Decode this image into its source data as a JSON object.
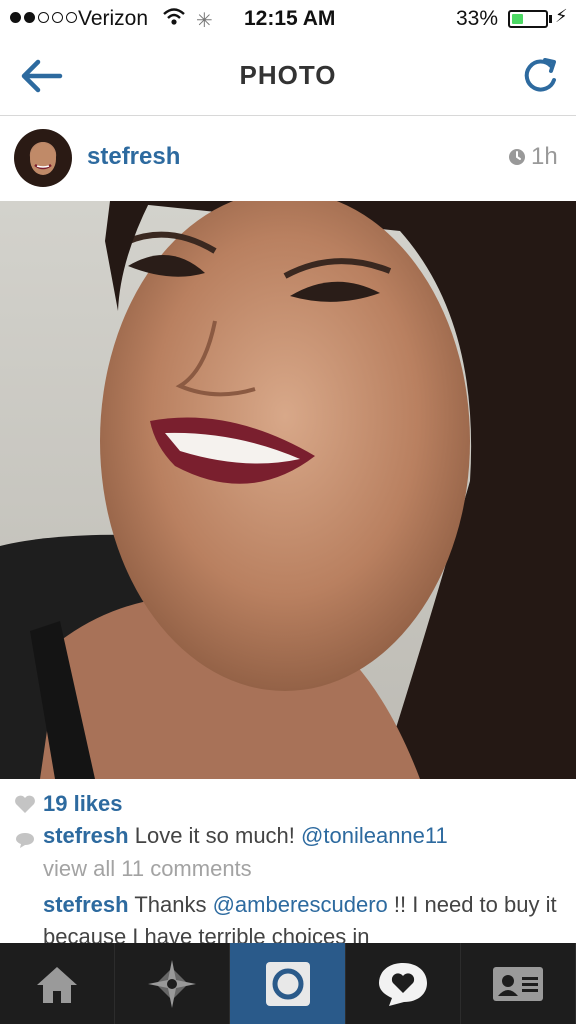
{
  "status_bar": {
    "carrier": "Verizon",
    "time": "12:15 AM",
    "battery_percent": "33%",
    "battery_level": 0.33,
    "signal_bars": 2
  },
  "nav": {
    "title": "PHOTO",
    "back_icon": "back-arrow-icon",
    "refresh_icon": "refresh-icon",
    "accent_color": "#2d6a9f"
  },
  "post": {
    "username": "stefresh",
    "time_ago": "1h",
    "likes": "19 likes",
    "caption": {
      "user": "stefresh",
      "text": "Love it so much!",
      "mention": "@tonileanne11"
    },
    "view_all": "view all 11 comments",
    "comments": [
      {
        "user": "stefresh",
        "text_before": "Thanks",
        "mention": "@amberescudero",
        "text_after": "!! I need to buy it because I have terrible choices in"
      }
    ]
  },
  "tab_bar": {
    "tabs": [
      {
        "icon": "home-icon"
      },
      {
        "icon": "explore-icon"
      },
      {
        "icon": "camera-icon",
        "active": true
      },
      {
        "icon": "activity-icon"
      },
      {
        "icon": "profile-icon"
      }
    ],
    "active_color": "#2a5a8a"
  }
}
